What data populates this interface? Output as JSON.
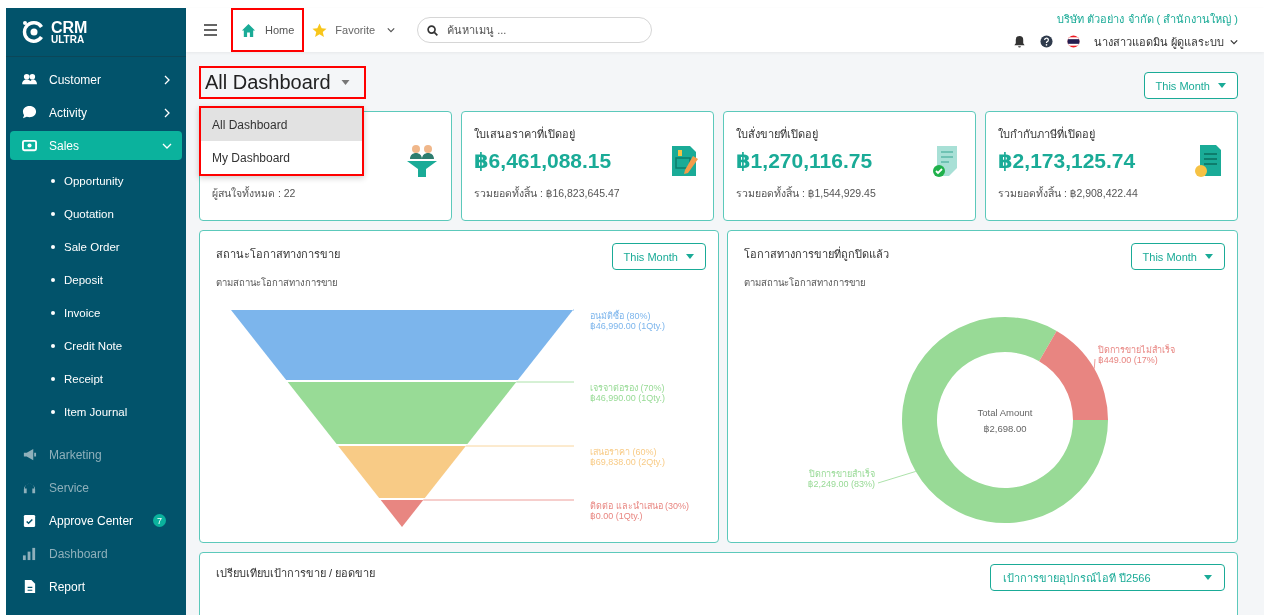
{
  "sidebar": {
    "logo": {
      "line1": "CRM",
      "line2": "ULTRA"
    },
    "items": [
      {
        "label": "Customer",
        "kind": "group",
        "expanded": false,
        "selected": false,
        "disabled": false
      },
      {
        "label": "Activity",
        "kind": "group",
        "expanded": false,
        "selected": false,
        "disabled": false
      },
      {
        "label": "Sales",
        "kind": "group",
        "expanded": true,
        "selected": true,
        "disabled": false,
        "children": [
          {
            "label": "Opportunity"
          },
          {
            "label": "Quotation"
          },
          {
            "label": "Sale Order"
          },
          {
            "label": "Deposit"
          },
          {
            "label": "Invoice"
          },
          {
            "label": "Credit Note"
          },
          {
            "label": "Receipt"
          },
          {
            "label": "Item Journal"
          }
        ]
      },
      {
        "label": "Marketing",
        "kind": "link",
        "selected": false,
        "disabled": true
      },
      {
        "label": "Service",
        "kind": "link",
        "selected": false,
        "disabled": true
      },
      {
        "label": "Approve Center",
        "kind": "link",
        "selected": false,
        "disabled": false,
        "badge": "7"
      },
      {
        "label": "Dashboard",
        "kind": "link",
        "selected": false,
        "disabled": true
      },
      {
        "label": "Report",
        "kind": "link",
        "selected": false,
        "disabled": false
      }
    ]
  },
  "header": {
    "home": {
      "label": "Home",
      "highlighted": true
    },
    "favorite": {
      "label": "Favorite"
    },
    "search": {
      "placeholder": "ค้นหาเมนู ..."
    },
    "company": "บริษัท ตัวอย่าง จำกัด ( สำนักงานใหญ่ )",
    "user": "นางสาวแอดมิน ผู้ดูแลระบบ"
  },
  "dashboard_select": {
    "value": "All Dashboard",
    "highlighted": true,
    "menu": {
      "highlighted": true,
      "items": [
        {
          "label": "All Dashboard",
          "selected": true
        },
        {
          "label": "My Dashboard",
          "selected": false
        }
      ]
    }
  },
  "period_button": "This Month",
  "stat_cards": [
    {
      "total": "ผู้สนใจทั้งหมด : 22"
    },
    {
      "title": "ใบเสนอราคาที่เปิดอยู่",
      "value": "฿6,461,088.15",
      "total": "รวมยอดทั้งสิ้น : ฿16,823,645.47"
    },
    {
      "title": "ใบสั่งขายที่เปิดอยู่",
      "value": "฿1,270,116.75",
      "total": "รวมยอดทั้งสิ้น : ฿1,544,929.45"
    },
    {
      "title": "ใบกำกับภาษีที่เปิดอยู่",
      "value": "฿2,173,125.74",
      "total": "รวมยอดทั้งสิ้น : ฿2,908,422.44"
    }
  ],
  "funnel_panel": {
    "title": "สถานะโอกาสทางการขาย",
    "subtitle": "ตามสถานะโอกาสทางการขาย",
    "period": "This Month",
    "stages": [
      {
        "label": "อนุมัติซื้อ (80%)",
        "amount": "฿46,990.00 (1Qty.)",
        "color": "#7cb5ec"
      },
      {
        "label": "เจรจาต่อรอง (70%)",
        "amount": "฿46,990.00 (1Qty.)",
        "color": "#98db96"
      },
      {
        "label": "เสนอราคา (60%)",
        "amount": "฿69,838.00 (2Qty.)",
        "color": "#f8cb86"
      },
      {
        "label": "ติดต่อ และนำเสนอ (30%)",
        "amount": "฿0.00 (1Qty.)",
        "color": "#e88681"
      }
    ]
  },
  "closed_panel": {
    "title": "โอกาสทางการขายที่ถูกปิดแล้ว",
    "subtitle": "ตามสถานะโอกาสทางการขาย",
    "period": "This Month",
    "center_label": "Total Amount",
    "center_value": "฿2,698.00",
    "slices": [
      {
        "color": "#98da96"
      },
      {
        "color": "#e88581"
      }
    ],
    "chart_data": {
      "type": "donut",
      "categories": [
        "ปิดการขายสำเร็จ",
        "ปิดการขายไม่สำเร็จ"
      ],
      "values": [
        2249,
        449
      ],
      "value_labels": [
        "฿2,249.00 (83%)",
        "฿449.00 (17%)"
      ]
    }
  },
  "target_panel": {
    "title": "เปรียบเทียบเป้าการขาย / ยอดขาย",
    "select": "เป้าการขายอุปกรณ์ไอที ปี2566"
  }
}
